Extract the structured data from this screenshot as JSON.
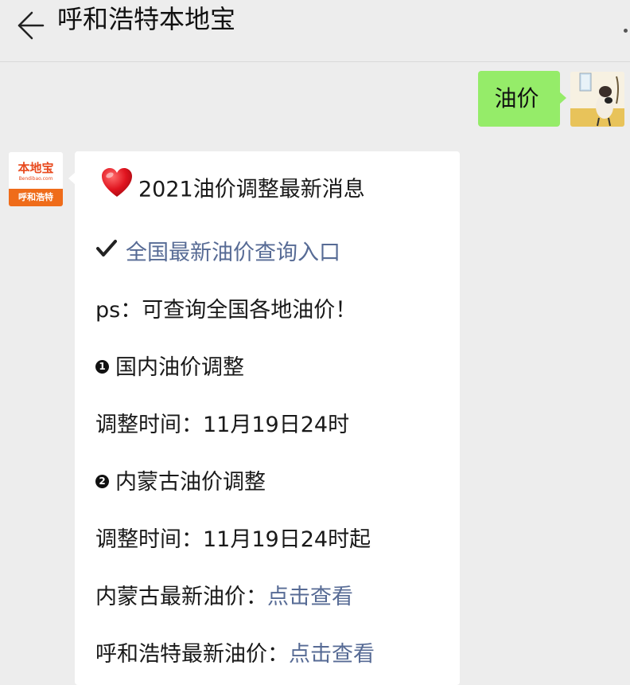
{
  "header": {
    "title": "呼和浩特本地宝"
  },
  "outgoing": {
    "text": "油价"
  },
  "bot": {
    "logo_text": "本地宝",
    "logo_sub": "Bendibao.com",
    "logo_city": "呼和浩特"
  },
  "message": {
    "headline": "2021油价调整最新消息",
    "query_link": "全国最新油价查询入口",
    "ps_note": "ps：可查询全国各地油价！",
    "section1": {
      "badge": "1",
      "title": "国内油价调整",
      "time": "调整时间：11月19日24时"
    },
    "section2": {
      "badge": "2",
      "title": "内蒙古油价调整",
      "time": "调整时间：11月19日24时起"
    },
    "nm_label": "内蒙古最新油价：",
    "nm_link": "点击查看",
    "hh_label": "呼和浩特最新油价：",
    "hh_link": "点击查看"
  },
  "colors": {
    "bubble_green": "#95ec69",
    "link_blue": "#576b95",
    "background": "#ededed"
  },
  "icons": [
    "back-arrow-icon",
    "more-icon",
    "heart-icon",
    "checkmark-icon"
  ]
}
